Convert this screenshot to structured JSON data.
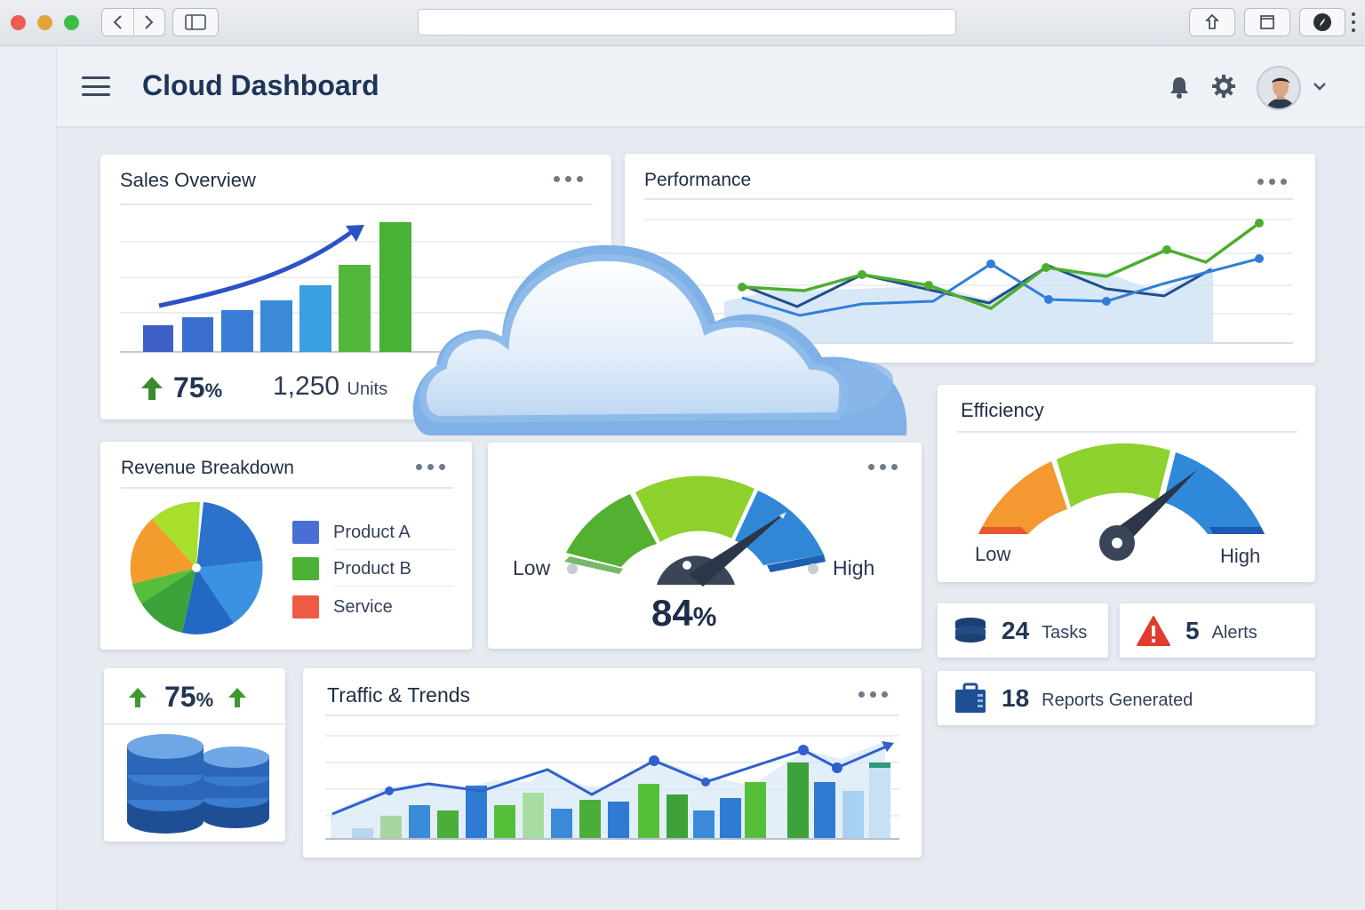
{
  "app": {
    "title": "Cloud Dashboard"
  },
  "colors": {
    "blue": "#2f6fd0",
    "green": "#45b03a",
    "orange": "#f59a2b",
    "red": "#e8543f",
    "navy": "#223654"
  },
  "sales": {
    "title": "Sales Overview",
    "growth_value": "75",
    "growth_unit": "%",
    "units_value": "1,250",
    "units_label": "Units",
    "bars": [
      1,
      2,
      3,
      4,
      5,
      6,
      7
    ]
  },
  "performance": {
    "title": "Performance"
  },
  "revenue": {
    "title": "Revenue Breakdown",
    "legend": [
      {
        "label": "Product A",
        "color": "#4a6fd2"
      },
      {
        "label": "Product B",
        "color": "#4cb236"
      },
      {
        "label": "Service",
        "color": "#ef5a45"
      }
    ]
  },
  "gauge": {
    "low": "Low",
    "high": "High",
    "value": "84",
    "unit": "%",
    "level": 0.84
  },
  "efficiency": {
    "title": "Efficiency",
    "low": "Low",
    "high": "High"
  },
  "stats": {
    "tasks_count": "24",
    "tasks_label": "Tasks",
    "alerts_count": "5",
    "alerts_label": "Alerts",
    "reports_count": "18",
    "reports_label": "Reports Generated"
  },
  "storage": {
    "value": "75",
    "unit": "%"
  },
  "traffic": {
    "title": "Traffic & Trends"
  }
}
